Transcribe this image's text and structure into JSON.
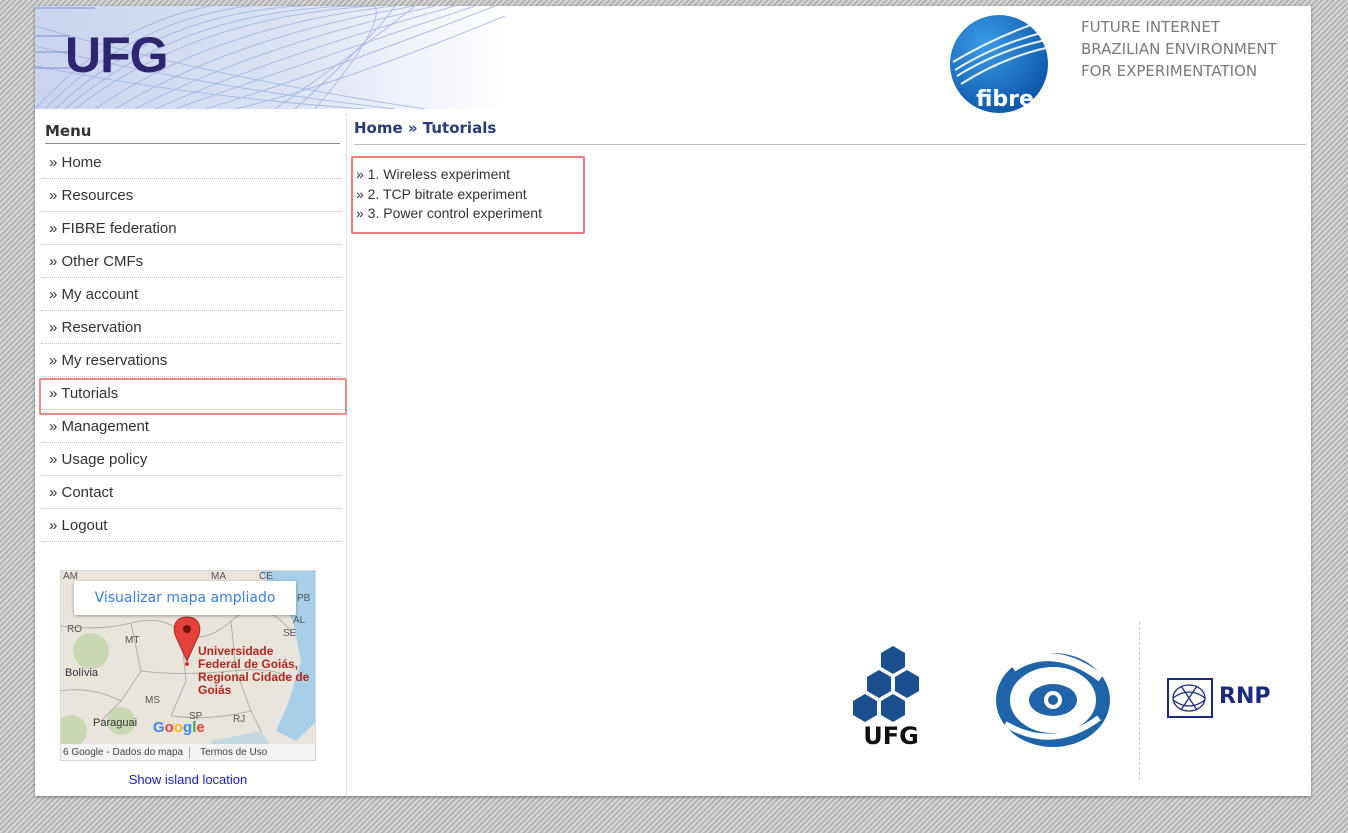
{
  "header": {
    "banner_title": "UFG",
    "fibre_logo_text": "fibre",
    "tagline": [
      "FUTURE INTERNET",
      "BRAZILIAN ENVIRONMENT",
      "FOR EXPERIMENTATION"
    ]
  },
  "sidebar": {
    "heading": "Menu",
    "items": [
      {
        "label": "» Home"
      },
      {
        "label": "» Resources"
      },
      {
        "label": "» FIBRE federation"
      },
      {
        "label": "» Other CMFs"
      },
      {
        "label": "» My account"
      },
      {
        "label": "» Reservation"
      },
      {
        "label": "» My reservations"
      },
      {
        "label": "» Tutorials"
      },
      {
        "label": "» Management"
      },
      {
        "label": "» Usage policy"
      },
      {
        "label": "» Contact"
      },
      {
        "label": "» Logout"
      }
    ],
    "map": {
      "enlarge_button": "Visualizar mapa ampliado",
      "labels": [
        "AM",
        "MA",
        "CE",
        "PB",
        "RO",
        "MT",
        "AL",
        "SE",
        "MS",
        "SP",
        "RJ"
      ],
      "bolivia": "Bolívia",
      "paraguai": "Paraguai",
      "place_name": "Universidade Federal de Goiás, Regional Cidade de Goiás",
      "google": "Google",
      "attribution": "6 Google - Dados do mapa",
      "terms": "Termos de Uso"
    },
    "island_link": "Show island location"
  },
  "main": {
    "breadcrumb": "Home » Tutorials",
    "tutorials": [
      {
        "label": "» 1. Wireless experiment"
      },
      {
        "label": "» 2. TCP bitrate experiment"
      },
      {
        "label": "» 3. Power control experiment"
      }
    ]
  },
  "footer": {
    "ufg_text": "UFG",
    "rnp_text": "RNP"
  },
  "colors": {
    "accent_blue": "#2b3a7d",
    "highlight_red": "#ee7b7b",
    "link_blue": "#1a1ad6",
    "ufg_purple": "#2e2470",
    "fibre_blue": "#1a6fc4"
  }
}
